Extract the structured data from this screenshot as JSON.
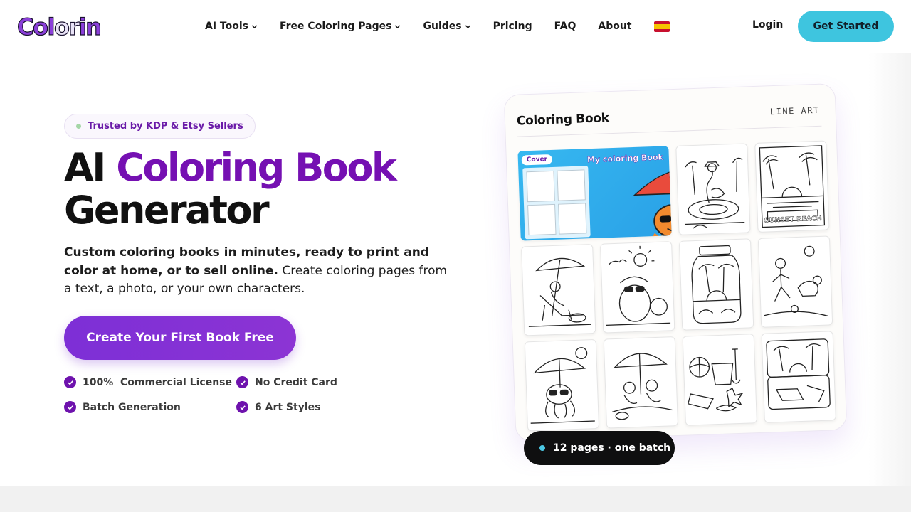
{
  "brand": {
    "logo_part1": "Col",
    "logo_part2": "or",
    "logo_part3": "in"
  },
  "nav": {
    "items": [
      {
        "label": "AI Tools",
        "has_dropdown": true
      },
      {
        "label": "Free Coloring Pages",
        "has_dropdown": true
      },
      {
        "label": "Guides",
        "has_dropdown": true
      },
      {
        "label": "Pricing",
        "has_dropdown": false
      },
      {
        "label": "FAQ",
        "has_dropdown": false
      },
      {
        "label": "About",
        "has_dropdown": false
      }
    ],
    "language_flag": "spain-flag-icon",
    "login_label": "Login",
    "cta_label": "Get Started"
  },
  "hero": {
    "badge": "Trusted by KDP & Etsy Sellers",
    "title_prefix": "AI",
    "title_accent": "Coloring Book",
    "title_suffix": "Generator",
    "subtitle_strong": "Custom coloring books in minutes, ready to print and color at home, or to sell online.",
    "subtitle_rest": "Create coloring pages from a text, a photo, or your own characters.",
    "cta_label": "Create Your First Book Free",
    "features": [
      "100%  Commercial License",
      "No Credit Card",
      "Batch Generation",
      "6 Art Styles"
    ]
  },
  "preview": {
    "card_title": "Coloring Book",
    "card_tag": "LINE ART",
    "cover_tag": "Cover",
    "cover_heading": "My coloring Book",
    "beach_sign": "SUNSET BEACH",
    "pill_label": "12 pages · one batch"
  },
  "colors": {
    "accent_purple": "#7510b2",
    "cta_cyan": "#3ec5df",
    "cover_blue": "#2aa1e7"
  }
}
